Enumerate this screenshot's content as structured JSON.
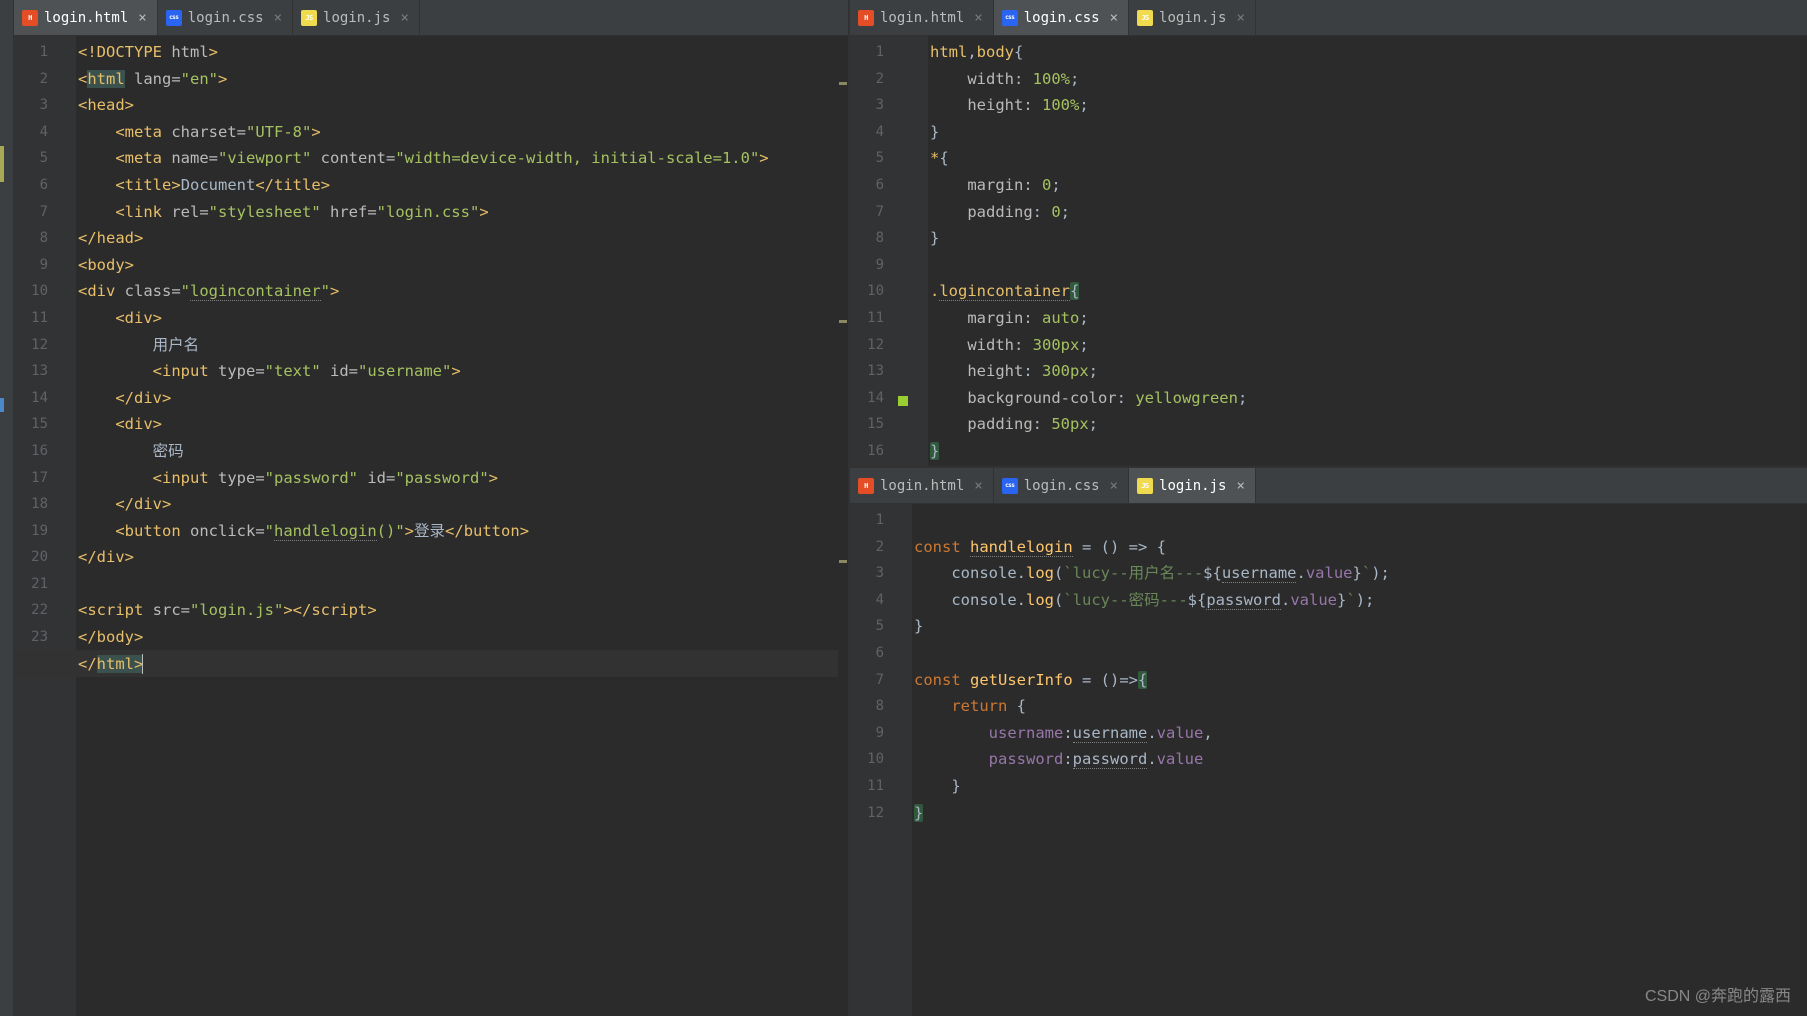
{
  "leftPane": {
    "tabs": [
      {
        "label": "login.html",
        "icon": "html",
        "active": true
      },
      {
        "label": "login.css",
        "icon": "css",
        "active": false
      },
      {
        "label": "login.js",
        "icon": "js",
        "active": false
      }
    ],
    "lineCount": 24,
    "code": [
      "<!DOCTYPE html>",
      "<html lang=\"en\">",
      "<head>",
      "    <meta charset=\"UTF-8\">",
      "    <meta name=\"viewport\" content=\"width=device-width, initial-scale=1.0\">",
      "    <title>Document</title>",
      "    <link rel=\"stylesheet\" href=\"login.css\">",
      "</head>",
      "<body>",
      "<div class=\"logincontainer\">",
      "    <div>",
      "        用户名",
      "        <input type=\"text\" id=\"username\">",
      "    </div>",
      "    <div>",
      "        密码",
      "        <input type=\"password\" id=\"password\">",
      "    </div>",
      "    <button onclick=\"handlelogin()\">登录</button>",
      "</div>",
      "",
      "<script src=\"login.js\"></script>",
      "</body>",
      "</html>"
    ]
  },
  "rightTopPane": {
    "tabs": [
      {
        "label": "login.html",
        "icon": "html",
        "active": false
      },
      {
        "label": "login.css",
        "icon": "css",
        "active": true
      },
      {
        "label": "login.js",
        "icon": "js",
        "active": false
      }
    ],
    "lineCount": 16,
    "code": [
      "html,body{",
      "    width: 100%;",
      "    height: 100%;",
      "}",
      "*{",
      "    margin: 0;",
      "    padding: 0;",
      "}",
      "",
      ".logincontainer{",
      "    margin: auto;",
      "    width: 300px;",
      "    height: 300px;",
      "    background-color: yellowgreen;",
      "    padding: 50px;",
      "}"
    ]
  },
  "rightBottomPane": {
    "tabs": [
      {
        "label": "login.html",
        "icon": "html",
        "active": false
      },
      {
        "label": "login.css",
        "icon": "css",
        "active": false
      },
      {
        "label": "login.js",
        "icon": "js",
        "active": true
      }
    ],
    "lineCount": 12,
    "code": [
      "",
      "const handlelogin = () => {",
      "    console.log(`lucy--用户名---${username.value}`);",
      "    console.log(`lucy--密码---${password.value}`);",
      "}",
      "",
      "const getUserInfo = ()=>{",
      "    return {",
      "        username:username.value,",
      "        password:password.value",
      "    }",
      "}"
    ]
  },
  "watermark": "CSDN @奔跑的露西"
}
